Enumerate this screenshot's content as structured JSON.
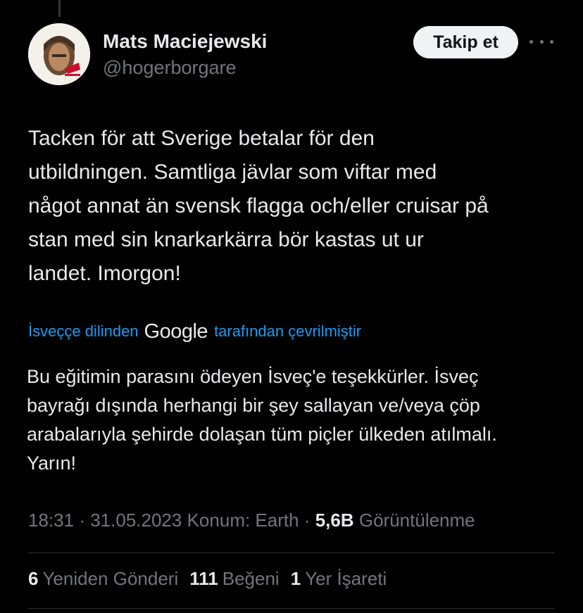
{
  "author": {
    "display_name": "Mats Maciejewski",
    "handle": "@hogerborgare",
    "follow_label": "Takip et"
  },
  "tweet": {
    "text_lines": [
      "Tacken för att Sverige betalar för den",
      "utbildningen. Samtliga jävlar som viftar med",
      "något annat än svensk flagga och/eller cruisar på",
      "stan med sin knarkarkärra bör kastas ut ur",
      "landet. Imorgon!"
    ]
  },
  "translation": {
    "prefix": "İsveççe dilinden",
    "provider": "Google",
    "suffix": "tarafından çevrilmiştir",
    "text_lines": [
      "Bu eğitimin parasını ödeyen İsveç'e teşekkürler. İsveç",
      "bayrağı dışında herhangi bir şey sallayan ve/veya çöp",
      "arabalarıyla şehirde dolaşan tüm piçler ülkeden atılmalı.",
      "Yarın!"
    ]
  },
  "meta": {
    "time": "18:31",
    "separator": "·",
    "date": "31.05.2023",
    "location": "Konum: Earth",
    "views_count": "5,6B",
    "views_label": "Görüntülenme"
  },
  "stats": {
    "reposts_count": "6",
    "reposts_label": "Yeniden Gönderi",
    "likes_count": "111",
    "likes_label": "Beğeni",
    "bookmarks_count": "1",
    "bookmarks_label": "Yer İşareti"
  },
  "colors": {
    "background": "#000000",
    "primary_text": "#e7e9ea",
    "secondary_text": "#71767b",
    "link": "#1d9bf0",
    "button_bg": "#eff3f4",
    "divider": "#2f3336"
  },
  "icons": {
    "more": "more-horizontal-icon"
  }
}
